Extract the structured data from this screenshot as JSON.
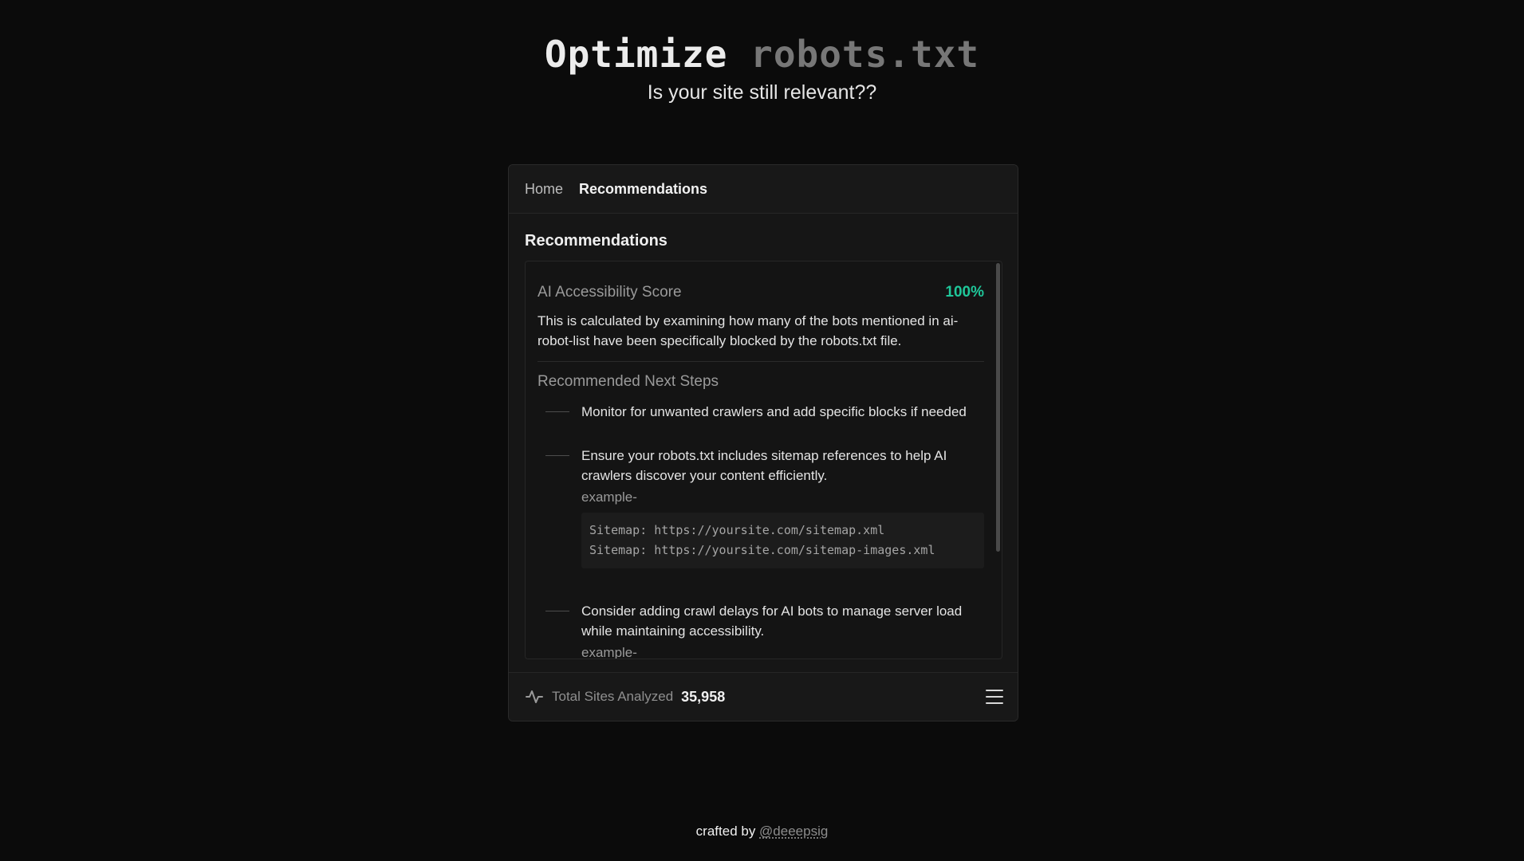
{
  "hero": {
    "title_main": "Optimize ",
    "title_accent": "robots.txt",
    "subtitle": "Is your site still relevant??"
  },
  "nav": {
    "items": [
      {
        "label": "Home",
        "active": false
      },
      {
        "label": "Recommendations",
        "active": true
      }
    ]
  },
  "recommendations": {
    "heading": "Recommendations",
    "score": {
      "label": "AI Accessibility Score",
      "value": "100%",
      "description": "This is calculated by examining how many of the bots mentioned in ai-robot-list have been specifically blocked by the robots.txt file."
    },
    "steps_title": "Recommended Next Steps",
    "steps": [
      {
        "text": "Monitor for unwanted crawlers and add specific blocks if needed"
      },
      {
        "text": "Ensure your robots.txt includes sitemap references to help AI crawlers discover your content efficiently.",
        "example_label": "example-",
        "code_lines": [
          "Sitemap: https://yoursite.com/sitemap.xml",
          "Sitemap: https://yoursite.com/sitemap-images.xml"
        ]
      },
      {
        "text": "Consider adding crawl delays for AI bots to manage server load while maintaining accessibility.",
        "example_label": "example-"
      }
    ]
  },
  "footer": {
    "label": "Total Sites Analyzed",
    "count": "35,958",
    "icon": "activity-pulse-icon",
    "menu_icon": "hamburger-menu-icon"
  },
  "credit": {
    "prefix": "crafted by ",
    "handle": "@deeepsig"
  },
  "colors": {
    "background": "#0b0b0b",
    "card": "#161616",
    "accent_green": "#1fc79a",
    "muted_text": "#9a9a9a"
  }
}
